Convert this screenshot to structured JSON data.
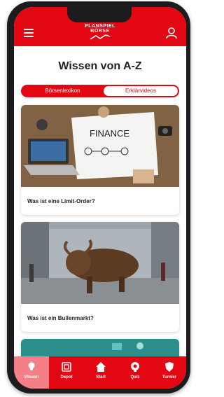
{
  "header": {
    "logo_line1": "PLANSPIEL",
    "logo_line2": "BÖRSE"
  },
  "page": {
    "title": "Wissen von A-Z"
  },
  "segment": {
    "left_label": "Börsenlexikon",
    "right_label": "Erklärvideos",
    "selected": "Erklärvideos"
  },
  "cards": [
    {
      "image_text": "FINANCE",
      "title": "Was ist eine Limit-Order?"
    },
    {
      "title": "Was ist ein Bullenmarkt?"
    }
  ],
  "bottom_nav": [
    {
      "label": "Wissen",
      "icon": "lightbulb-icon",
      "active": true
    },
    {
      "label": "Depot",
      "icon": "wallet-icon",
      "active": false
    },
    {
      "label": "Start",
      "icon": "home-icon",
      "active": false
    },
    {
      "label": "Quiz",
      "icon": "quiz-icon",
      "active": false
    },
    {
      "label": "Turnier",
      "icon": "shield-icon",
      "active": false
    }
  ],
  "colors": {
    "brand_red": "#e30613",
    "active_tab": "#f47f86",
    "background": "#ffffff"
  }
}
